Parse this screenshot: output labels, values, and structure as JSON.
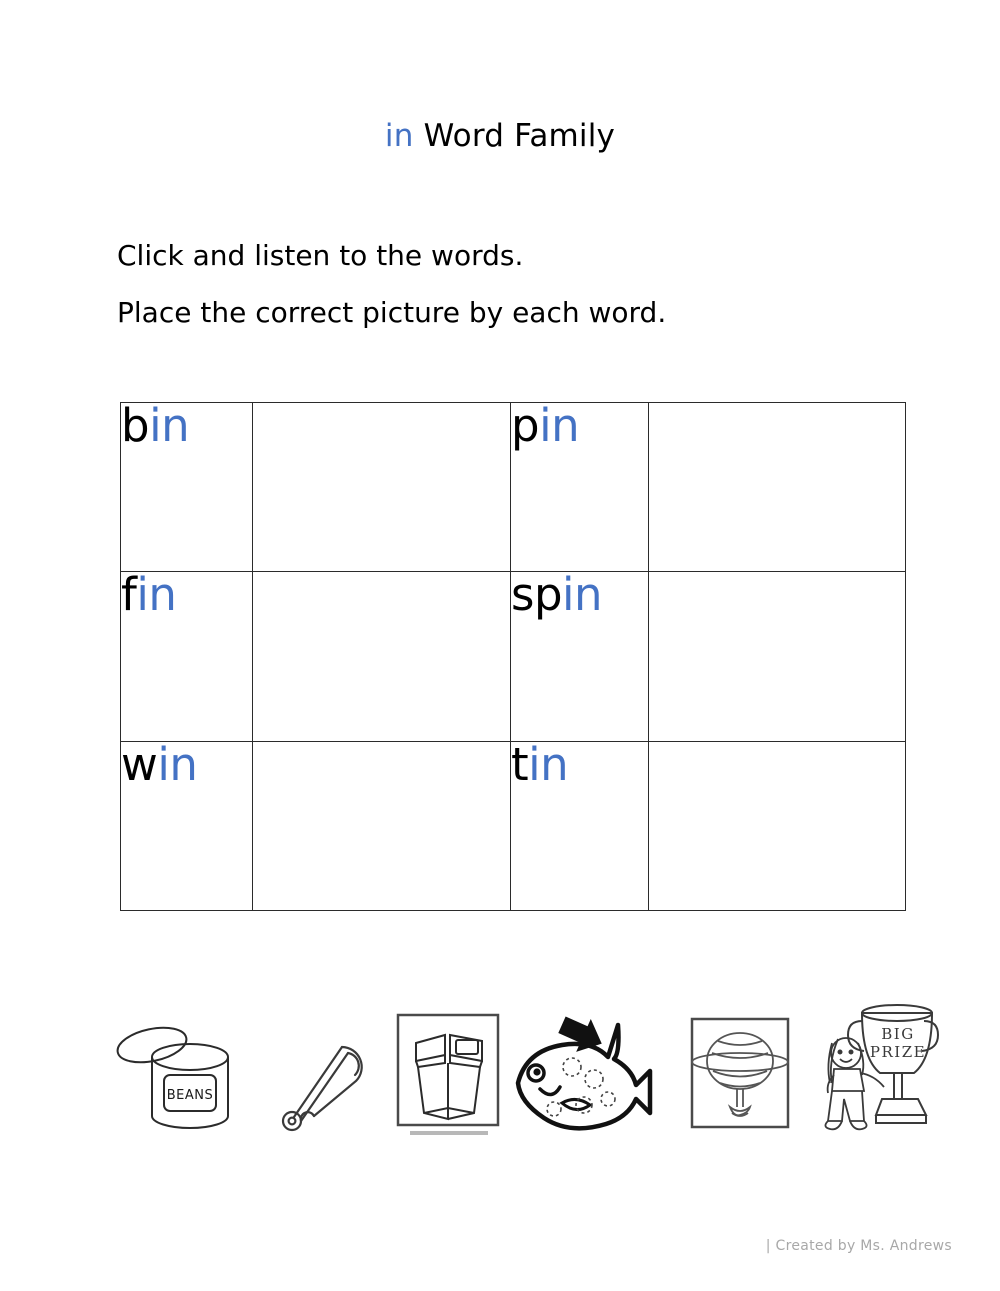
{
  "title": {
    "rime": "in",
    "rest": " Word Family"
  },
  "instructions": {
    "line1": "Click and listen to the words.",
    "line2": "Place the correct picture by each word."
  },
  "colors": {
    "rime_blue": "#4472C4",
    "text_black": "#000000",
    "table_border": "#2b2b2b",
    "footer_gray": "#a8a8a8"
  },
  "table": {
    "rows": [
      {
        "cells": [
          {
            "type": "word",
            "onset": "b",
            "rime": "in",
            "word": "bin"
          },
          {
            "type": "drop",
            "label": ""
          },
          {
            "type": "word",
            "onset": "p",
            "rime": "in",
            "word": "pin"
          },
          {
            "type": "drop",
            "label": ""
          }
        ]
      },
      {
        "cells": [
          {
            "type": "word",
            "onset": "f",
            "rime": "in",
            "word": "fin"
          },
          {
            "type": "drop",
            "label": ""
          },
          {
            "type": "word",
            "onset": "sp",
            "rime": "in",
            "word": "spin"
          },
          {
            "type": "drop",
            "label": ""
          }
        ]
      },
      {
        "cells": [
          {
            "type": "word",
            "onset": "w",
            "rime": "in",
            "word": "win"
          },
          {
            "type": "drop",
            "label": ""
          },
          {
            "type": "word",
            "onset": "t",
            "rime": "in",
            "word": "tin"
          },
          {
            "type": "drop",
            "label": ""
          }
        ]
      }
    ]
  },
  "pictures": [
    {
      "icon": "tin-can-icon",
      "label": "tin",
      "caption": "BEANS"
    },
    {
      "icon": "safety-pin-icon",
      "label": "pin",
      "caption": ""
    },
    {
      "icon": "trash-bin-icon",
      "label": "bin",
      "caption": ""
    },
    {
      "icon": "fish-fin-icon",
      "label": "fin",
      "caption": ""
    },
    {
      "icon": "spinning-top-icon",
      "label": "spin",
      "caption": ""
    },
    {
      "icon": "trophy-win-icon",
      "label": "win",
      "caption": "BIG PRIZE"
    }
  ],
  "footer": {
    "credit": "| Created  by Ms. Andrews"
  }
}
